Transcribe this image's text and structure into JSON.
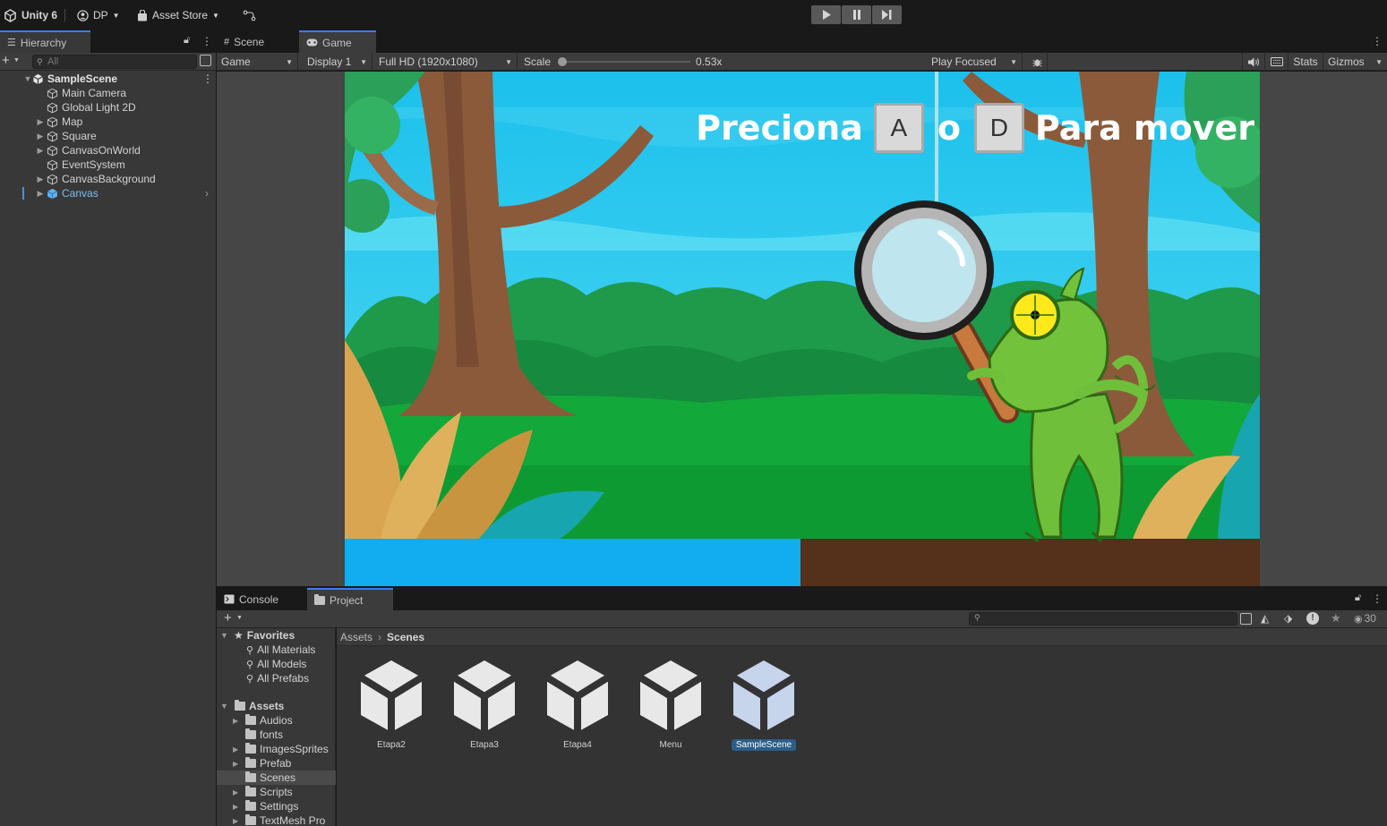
{
  "toolbar": {
    "app_name": "Unity 6",
    "account": "DP",
    "asset_store": "Asset Store"
  },
  "hierarchy": {
    "tab_label": "Hierarchy",
    "search_placeholder": "All",
    "scene": "SampleScene",
    "items": [
      {
        "label": "Main Camera"
      },
      {
        "label": "Global Light 2D"
      },
      {
        "label": "Map"
      },
      {
        "label": "Square"
      },
      {
        "label": "CanvasOnWorld"
      },
      {
        "label": "EventSystem"
      },
      {
        "label": "CanvasBackground"
      },
      {
        "label": "Canvas"
      }
    ]
  },
  "game_view": {
    "tabs": [
      {
        "label": "Scene"
      },
      {
        "label": "Game"
      }
    ],
    "mode": "Game",
    "display": "Display 1",
    "resolution": "Full HD (1920x1080)",
    "scale_label": "Scale",
    "scale_value": "0.53x",
    "play_focus": "Play Focused",
    "stats": "Stats",
    "gizmos": "Gizmos",
    "scale_level": 0
  },
  "game_content": {
    "prompt_word1": "Preciona",
    "key1": "A",
    "prompt_word2": "o",
    "key2": "D",
    "prompt_word3": "Para mover"
  },
  "bottom": {
    "tabs": [
      {
        "label": "Console"
      },
      {
        "label": "Project"
      }
    ],
    "visible_count": "30",
    "breadcrumb": {
      "root": "Assets",
      "current": "Scenes"
    },
    "favorites": {
      "label": "Favorites",
      "items": [
        {
          "label": "All Materials"
        },
        {
          "label": "All Models"
        },
        {
          "label": "All Prefabs"
        }
      ]
    },
    "assets_root": "Assets",
    "folders": [
      {
        "label": "Audios"
      },
      {
        "label": "fonts"
      },
      {
        "label": "ImagesSprites"
      },
      {
        "label": "Prefab"
      },
      {
        "label": "Scenes"
      },
      {
        "label": "Scripts"
      },
      {
        "label": "Settings"
      },
      {
        "label": "TextMesh Pro"
      }
    ],
    "scene_assets": [
      {
        "label": "Etapa2"
      },
      {
        "label": "Etapa3"
      },
      {
        "label": "Etapa4"
      },
      {
        "label": "Menu"
      },
      {
        "label": "SampleScene"
      }
    ]
  }
}
